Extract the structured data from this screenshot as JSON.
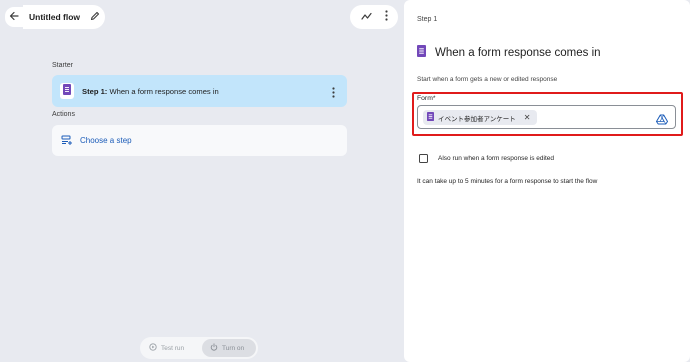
{
  "header": {
    "flow_title": "Untitled flow"
  },
  "starter": {
    "section_label": "Starter",
    "step_prefix": "Step 1:",
    "step_text": " When a form response comes in"
  },
  "actions": {
    "section_label": "Actions",
    "choose_label": "Choose a step"
  },
  "bottom": {
    "test_run_label": "Test run",
    "turn_on_label": "Turn on"
  },
  "panel": {
    "step_label": "Step 1",
    "heading": "When a form response comes in",
    "description": "Start when a form gets a new or edited response",
    "form_label": "Form*",
    "form_chip_label": "イベント参加者アンケート",
    "checkbox_label": "Also run when a form response is edited",
    "note": "It can take up to 5 minutes for a form response to start the flow"
  },
  "colors": {
    "forms_purple": "#7248b9",
    "step_card_bg": "#c2e5fb",
    "link_blue": "#1a5bb8",
    "highlight_red": "#e01b1b"
  }
}
